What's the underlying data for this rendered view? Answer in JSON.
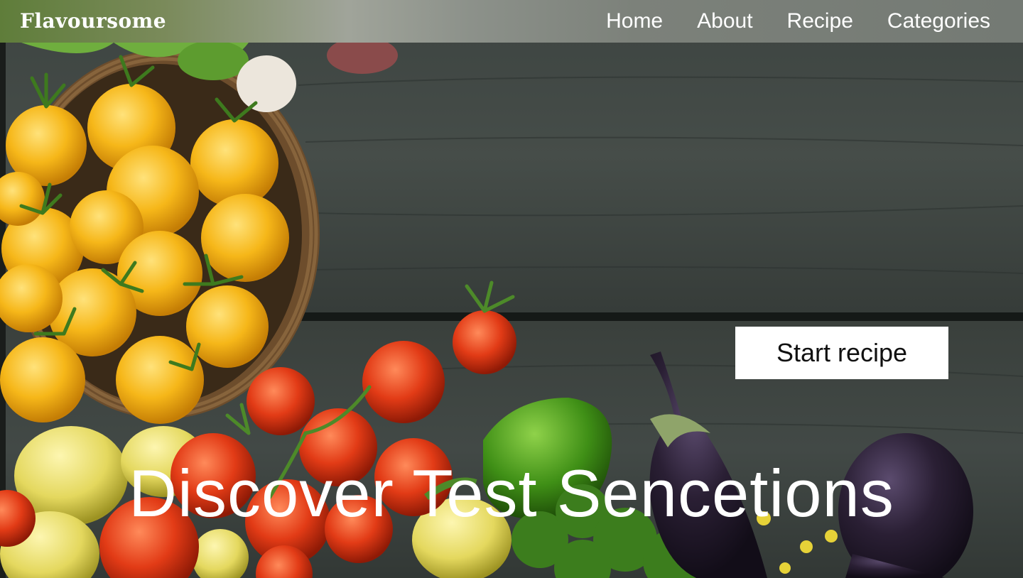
{
  "header": {
    "logo": "Flavoursome",
    "nav": [
      {
        "label": "Home"
      },
      {
        "label": "About"
      },
      {
        "label": "Recipe"
      },
      {
        "label": "Categories"
      }
    ]
  },
  "hero": {
    "button_label": "Start recipe",
    "heading": "Discover Test Sencetions",
    "image_description_icon": "vegetables-on-wooden-table"
  },
  "colors": {
    "navbar_start": "#5f7d3a",
    "navbar_end": "#747a74",
    "wood": "#3a403d",
    "text": "#ffffff",
    "button_bg": "#ffffff",
    "button_text": "#111111"
  }
}
